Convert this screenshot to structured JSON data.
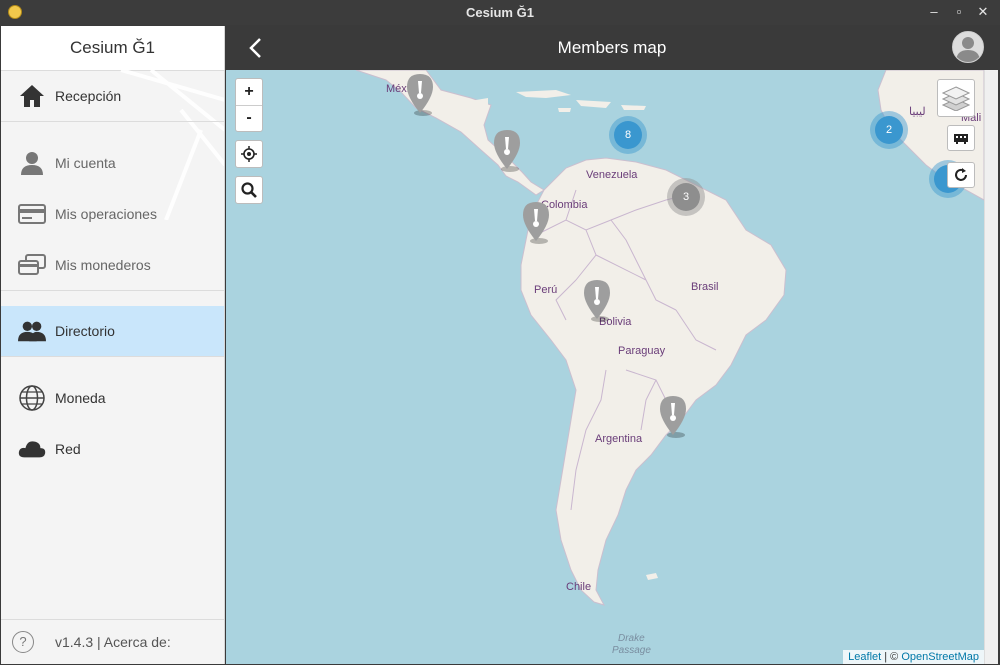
{
  "window": {
    "title": "Cesium Ğ1"
  },
  "sidebar": {
    "title": "Cesium Ğ1",
    "items": [
      {
        "label": "Recepción",
        "icon": "home-icon"
      },
      {
        "label": "Mi cuenta",
        "icon": "person-icon"
      },
      {
        "label": "Mis operaciones",
        "icon": "card-icon"
      },
      {
        "label": "Mis monederos",
        "icon": "cards-icon"
      },
      {
        "label": "Directorio",
        "icon": "people-icon"
      },
      {
        "label": "Moneda",
        "icon": "globe-icon"
      },
      {
        "label": "Red",
        "icon": "cloud-icon"
      }
    ],
    "active": "Directorio",
    "footer": {
      "help": "?",
      "version": "v1.4.3 | Acerca de:"
    }
  },
  "header": {
    "title": "Members map",
    "back_icon": "chevron-left-icon",
    "avatar_icon": "user-avatar-icon"
  },
  "map": {
    "zoom_in": "+",
    "zoom_out": "-",
    "countries": [
      "México",
      "Venezuela",
      "Colombia",
      "Perú",
      "Brasil",
      "Bolivia",
      "Paraguay",
      "Argentina",
      "Chile",
      "Mali",
      "ليبيا"
    ],
    "sea_label": [
      "Drake",
      "Passage"
    ],
    "clusters": [
      {
        "count": "8"
      },
      {
        "count": "2"
      },
      {
        "count": "3"
      }
    ],
    "attribution": {
      "leaflet": "Leaflet",
      "sep": " | © ",
      "osm": "OpenStreetMap"
    },
    "colors": {
      "water": "#aad3df",
      "land": "#f2efe9",
      "cluster_blue": "#3a97cf",
      "cluster_grey": "#8e8e8e",
      "active_bg": "#c9e6fb"
    }
  }
}
